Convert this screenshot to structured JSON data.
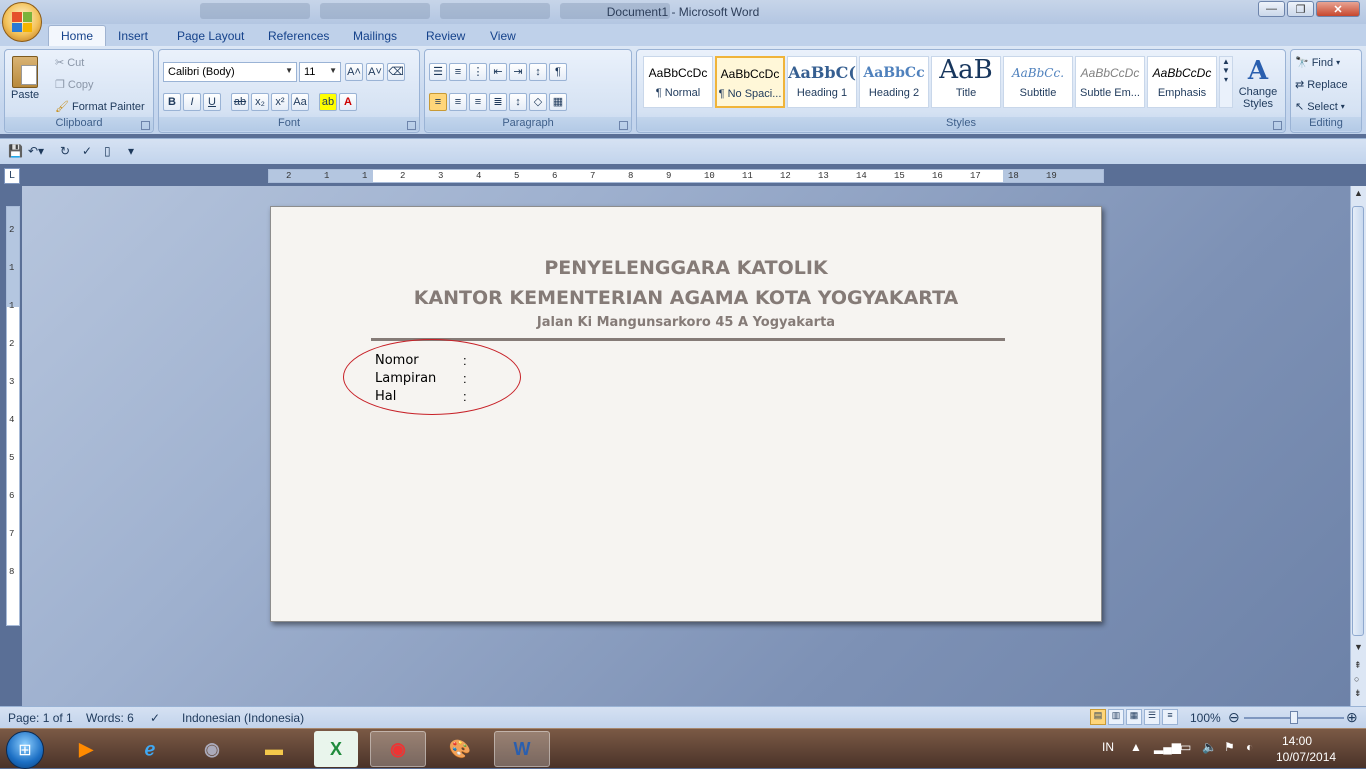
{
  "window": {
    "title": "Document1 - Microsoft Word"
  },
  "tabs": [
    "Home",
    "Insert",
    "Page Layout",
    "References",
    "Mailings",
    "Review",
    "View"
  ],
  "clipboard": {
    "paste": "Paste",
    "cut": "Cut",
    "copy": "Copy",
    "format_painter": "Format Painter",
    "label": "Clipboard"
  },
  "font": {
    "family": "Calibri (Body)",
    "size": "11",
    "label": "Font"
  },
  "paragraph": {
    "label": "Paragraph"
  },
  "styles": {
    "label": "Styles",
    "items": [
      {
        "preview": "AaBbCcDc",
        "name": "¶ Normal"
      },
      {
        "preview": "AaBbCcDc",
        "name": "¶ No Spaci..."
      },
      {
        "preview": "AaBbC(",
        "name": "Heading 1"
      },
      {
        "preview": "AaBbCc",
        "name": "Heading 2"
      },
      {
        "preview": "AaB",
        "name": "Title"
      },
      {
        "preview": "AaBbCc.",
        "name": "Subtitle"
      },
      {
        "preview": "AaBbCcDc",
        "name": "Subtle Em..."
      },
      {
        "preview": "AaBbCcDc",
        "name": "Emphasis"
      }
    ],
    "change_styles": "Change Styles"
  },
  "editing": {
    "find": "Find",
    "replace": "Replace",
    "select": "Select",
    "label": "Editing"
  },
  "ruler": {
    "ticks": [
      "2",
      "1",
      "1",
      "2",
      "3",
      "4",
      "5",
      "6",
      "7",
      "8",
      "9",
      "10",
      "11",
      "12",
      "13",
      "14",
      "15",
      "16",
      "17",
      "18",
      "19"
    ],
    "vticks": [
      "2",
      "1",
      "1",
      "2",
      "3",
      "4",
      "5",
      "6",
      "7",
      "8"
    ]
  },
  "document": {
    "line1": "PENYELENGGARA KATOLIK",
    "line2": "KANTOR KEMENTERIAN AGAMA KOTA YOGYAKARTA",
    "line3": "Jalan Ki Mangunsarkoro 45 A Yogyakarta",
    "fields": [
      {
        "label": "Nomor",
        "sep": ":"
      },
      {
        "label": "Lampiran",
        "sep": ":"
      },
      {
        "label": "Hal",
        "sep": ":"
      }
    ]
  },
  "status": {
    "page": "Page: 1 of 1",
    "words": "Words: 6",
    "language": "Indonesian (Indonesia)",
    "zoom": "100%"
  },
  "tray": {
    "lang": "IN",
    "time": "14:00",
    "date": "10/07/2014"
  }
}
